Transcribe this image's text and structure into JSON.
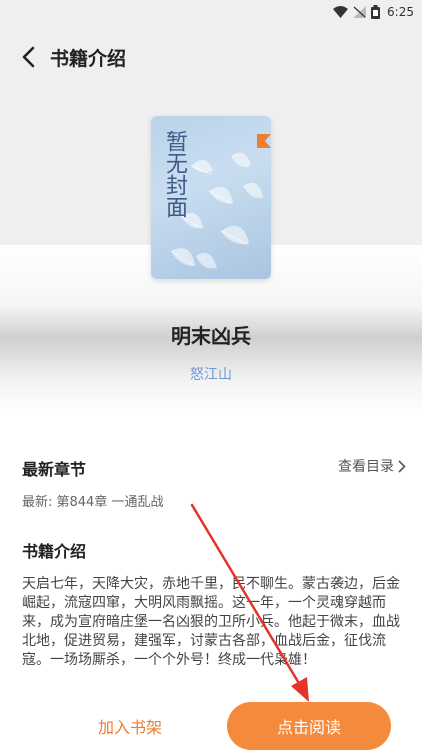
{
  "status_bar": {
    "time": "6:25"
  },
  "header": {
    "title": "书籍介绍"
  },
  "book": {
    "cover_text": "暂无封面",
    "name": "明末凶兵",
    "author": "怒江山"
  },
  "latest": {
    "heading": "最新章节",
    "catalog_link": "查看目录",
    "chapter": "最新: 第844章 一通乱战"
  },
  "intro": {
    "heading": "书籍介绍",
    "text": "天启七年，天降大灾，赤地千里，民不聊生。蒙古袭边，后金崛起，流寇四窜，大明风雨飘摇。这一年，一个灵魂穿越而来，成为宣府暗庄堡一名凶狠的卫所小兵。他起于微末，血战北地，促进贸易，建强军，讨蒙古各部，血战后金，征伐流寇。一场场厮杀，一个个外号！终成一代枭雄！"
  },
  "actions": {
    "add_to_shelf": "加入书架",
    "read": "点击阅读"
  },
  "colors": {
    "accent": "#f48a3b",
    "author": "#6d9ad4",
    "annotation": "#e5332a"
  }
}
